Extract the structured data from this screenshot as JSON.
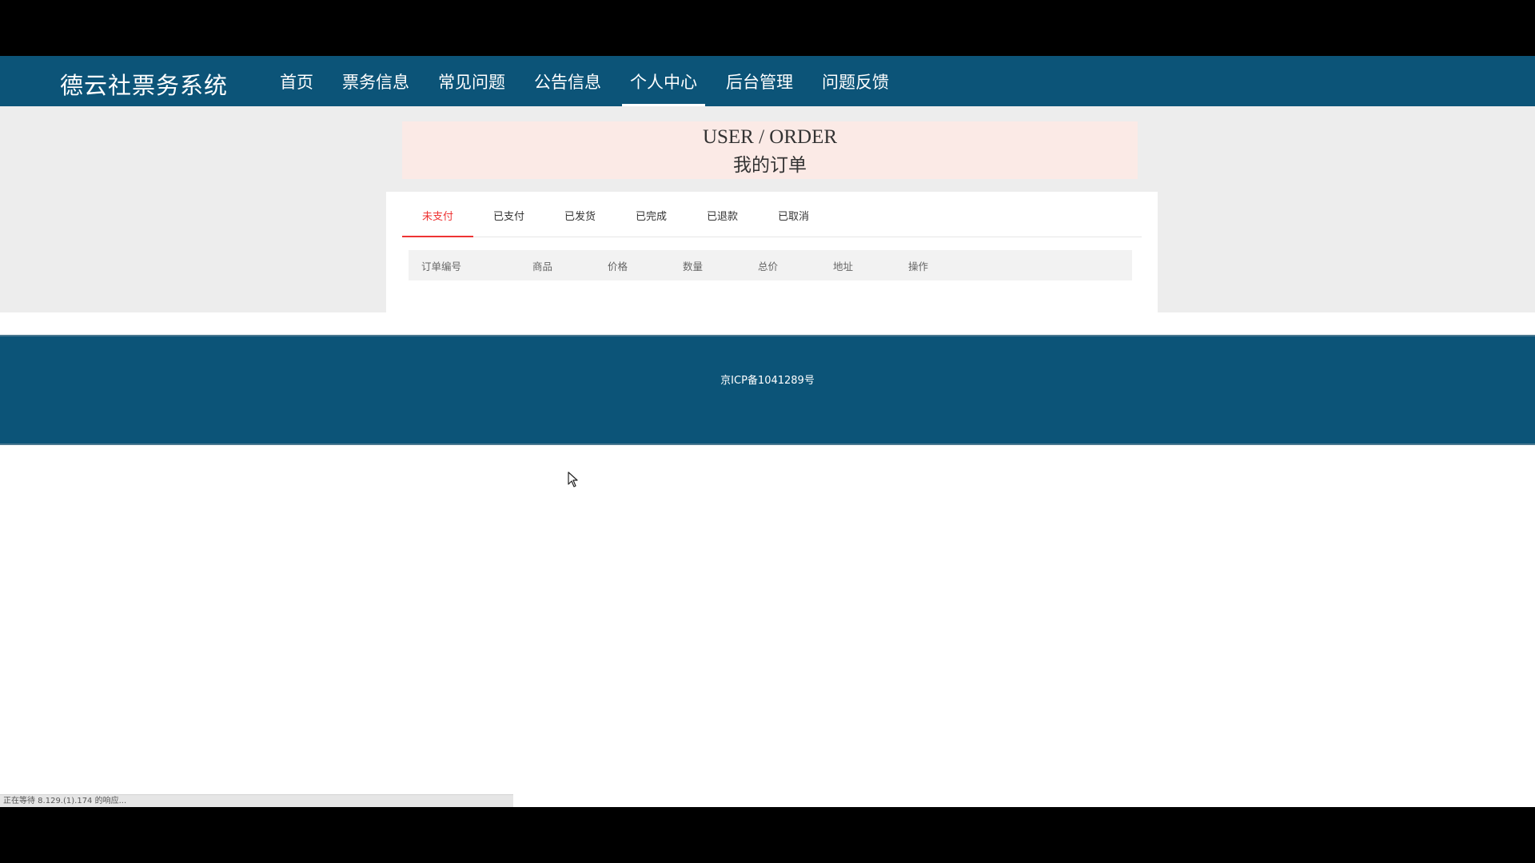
{
  "site_title": "德云社票务系统",
  "nav": [
    {
      "label": "首页",
      "active": false
    },
    {
      "label": "票务信息",
      "active": false
    },
    {
      "label": "常见问题",
      "active": false
    },
    {
      "label": "公告信息",
      "active": false
    },
    {
      "label": "个人中心",
      "active": true
    },
    {
      "label": "后台管理",
      "active": false
    },
    {
      "label": "问题反馈",
      "active": false
    }
  ],
  "page_heading": {
    "en": "USER / ORDER",
    "cn": "我的订单"
  },
  "order_tabs": [
    {
      "label": "未支付",
      "active": true
    },
    {
      "label": "已支付",
      "active": false
    },
    {
      "label": "已发货",
      "active": false
    },
    {
      "label": "已完成",
      "active": false
    },
    {
      "label": "已退款",
      "active": false
    },
    {
      "label": "已取消",
      "active": false
    }
  ],
  "table_columns": [
    "订单编号",
    "商品",
    "价格",
    "数量",
    "总价",
    "地址",
    "操作"
  ],
  "footer": {
    "icp": "京ICP备1041289号"
  },
  "status_bar": "正在等待 8.129.(1).174 的响应...",
  "colors": {
    "header_bg": "#0c5478",
    "active_tab": "#ee3333",
    "heading_bg": "#fbeae6"
  }
}
